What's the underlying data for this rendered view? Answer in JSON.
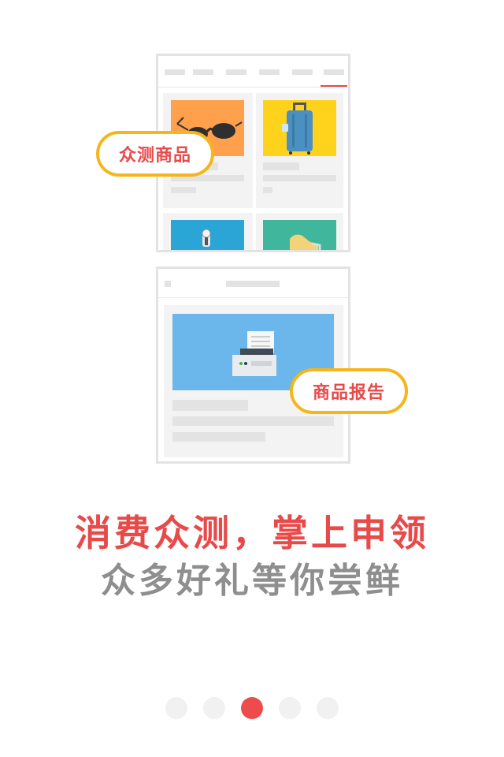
{
  "callouts": {
    "crowd_test_products": "众测商品",
    "product_reports": "商品报告"
  },
  "headline": {
    "primary": "消费众测，掌上申领",
    "secondary": "众多好礼等你尝鲜",
    "primary_color": "#e84a4a",
    "secondary_color": "#8e8e8e"
  },
  "pager": {
    "page_count": 5,
    "current_page": 3,
    "active_color": "#ee4b4d",
    "inactive_color": "#f1f1f1"
  },
  "icons": {
    "product_1": "sunglasses-icon",
    "product_2": "suitcase-icon",
    "product_3": "microscope-icon",
    "product_4": "shoe-icon",
    "report": "printer-icon"
  },
  "colors": {
    "accent_border": "#f6b51b",
    "tile_orange": "#ffa04c",
    "tile_yellow": "#ffd31c",
    "tile_blue": "#2ba4d6",
    "tile_teal": "#40b79c",
    "report_blue": "#6bb6ea"
  }
}
